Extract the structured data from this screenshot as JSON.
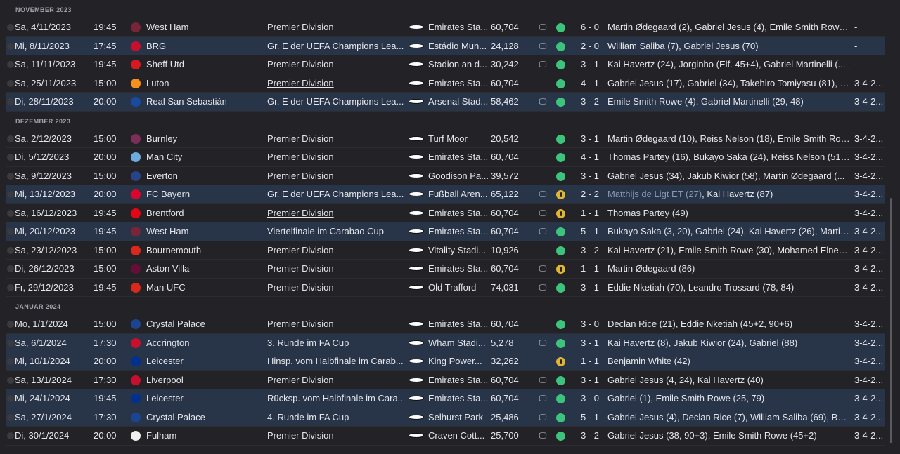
{
  "months": [
    {
      "label": "NOVEMBER 2023",
      "matches": [
        {
          "date": "Sa, 4/11/2023",
          "time": "19:45",
          "opponent": "West Ham",
          "crest": "#7a2437",
          "competition": "Premier Division",
          "comp_underline": false,
          "cup": false,
          "stadium": "Emirates Sta...",
          "attendance": "60,704",
          "tv": "tv-icon",
          "result": "win",
          "score": "6 - 0",
          "scorers": "Martin Ødegaard (2), Gabriel Jesus (4), Emile Smith Rowe...",
          "formation": "-"
        },
        {
          "date": "Mi, 8/11/2023",
          "time": "17:45",
          "opponent": "BRG",
          "crest": "#c8102e",
          "competition": "Gr. E der UEFA Champions Lea...",
          "comp_underline": false,
          "cup": true,
          "stadium": "Estádio Mun...",
          "attendance": "24,128",
          "tv": "tv-icon",
          "result": "win",
          "score": "2 - 0",
          "scorers": "William Saliba (7), Gabriel Jesus (70)",
          "formation": "-"
        },
        {
          "date": "Sa, 11/11/2023",
          "time": "19:45",
          "opponent": "Sheff Utd",
          "crest": "#d71920",
          "competition": "Premier Division",
          "comp_underline": false,
          "cup": false,
          "stadium": "Stadion an d...",
          "attendance": "30,242",
          "tv": "tv-icon",
          "result": "win",
          "score": "3 - 1",
          "scorers": "Kai Havertz (24), Jorginho (Elf. 45+4), Gabriel Martinelli (...",
          "formation": "-"
        },
        {
          "date": "Sa, 25/11/2023",
          "time": "15:00",
          "opponent": "Luton",
          "crest": "#f78f1e",
          "competition": "Premier Division",
          "comp_underline": true,
          "cup": false,
          "stadium": "Emirates Sta...",
          "attendance": "60,704",
          "tv": "",
          "result": "win",
          "score": "4 - 1",
          "scorers": "Gabriel Jesus (17), Gabriel (34), Takehiro Tomiyasu (81), B...",
          "formation": "3-4-2..."
        },
        {
          "date": "Di, 28/11/2023",
          "time": "20:00",
          "opponent": "Real San Sebastián",
          "crest": "#1a4aa0",
          "competition": "Gr. E der UEFA Champions Lea...",
          "comp_underline": false,
          "cup": true,
          "stadium": "Arsenal Stad...",
          "attendance": "58,462",
          "tv": "tv-icon",
          "result": "win",
          "score": "3 - 2",
          "scorers": "Emile Smith Rowe (4), Gabriel Martinelli (29, 48)",
          "formation": "3-4-2..."
        }
      ]
    },
    {
      "label": "DEZEMBER 2023",
      "matches": [
        {
          "date": "Sa, 2/12/2023",
          "time": "15:00",
          "opponent": "Burnley",
          "crest": "#7b2e57",
          "competition": "Premier Division",
          "comp_underline": false,
          "cup": false,
          "stadium": "Turf Moor",
          "attendance": "20,542",
          "tv": "",
          "result": "win",
          "score": "3 - 1",
          "scorers": "Martin Ødegaard (10), Reiss Nelson (18), Emile Smith Row...",
          "formation": "3-4-2..."
        },
        {
          "date": "Di, 5/12/2023",
          "time": "20:00",
          "opponent": "Man City",
          "crest": "#6cabdd",
          "competition": "Premier Division",
          "comp_underline": false,
          "cup": false,
          "stadium": "Emirates Sta...",
          "attendance": "60,704",
          "tv": "",
          "result": "win",
          "score": "4 - 1",
          "scorers": "Thomas Partey (16), Bukayo Saka (24), Reiss Nelson (51),...",
          "formation": "3-4-2..."
        },
        {
          "date": "Sa, 9/12/2023",
          "time": "15:00",
          "opponent": "Everton",
          "crest": "#274488",
          "competition": "Premier Division",
          "comp_underline": false,
          "cup": false,
          "stadium": "Goodison Pa...",
          "attendance": "39,572",
          "tv": "",
          "result": "win",
          "score": "3 - 1",
          "scorers": "Gabriel Jesus (34), Jakub Kiwior (58), Martin Ødegaard (...",
          "formation": "3-4-2..."
        },
        {
          "date": "Mi, 13/12/2023",
          "time": "20:00",
          "opponent": "FC Bayern",
          "crest": "#dc052d",
          "competition": "Gr. E der UEFA Champions Lea...",
          "comp_underline": false,
          "cup": true,
          "stadium": "Fußball Aren...",
          "attendance": "65,122",
          "tv": "tv-icon",
          "result": "draw",
          "score": "2 - 2",
          "scorers": "Matthijs de Ligt ET (27), Kai Havertz (87)",
          "scorer_against": "Matthijs de Ligt ET (27)",
          "scorer_rest": ", Kai Havertz (87)",
          "formation": "3-4-2..."
        },
        {
          "date": "Sa, 16/12/2023",
          "time": "19:45",
          "opponent": "Brentford",
          "crest": "#e30613",
          "competition": "Premier Division",
          "comp_underline": true,
          "cup": false,
          "stadium": "Emirates Sta...",
          "attendance": "60,704",
          "tv": "tv-icon",
          "result": "draw",
          "score": "1 - 1",
          "scorers": "Thomas Partey (49)",
          "formation": "3-4-2..."
        },
        {
          "date": "Mi, 20/12/2023",
          "time": "19:45",
          "opponent": "West Ham",
          "crest": "#7a2437",
          "competition": "Viertelfinale im Carabao Cup",
          "comp_underline": false,
          "cup": true,
          "stadium": "Emirates Sta...",
          "attendance": "60,704",
          "tv": "tv-icon",
          "result": "win",
          "score": "5 - 1",
          "scorers": "Bukayo Saka (3, 20), Gabriel (24), Kai Havertz (26), Martin...",
          "formation": "3-4-2..."
        },
        {
          "date": "Sa, 23/12/2023",
          "time": "15:00",
          "opponent": "Bournemouth",
          "crest": "#da291c",
          "competition": "Premier Division",
          "comp_underline": false,
          "cup": false,
          "stadium": "Vitality Stadi...",
          "attendance": "10,926",
          "tv": "",
          "result": "win",
          "score": "3 - 2",
          "scorers": "Kai Havertz (21), Emile Smith Rowe (30), Mohamed Elnen...",
          "formation": "3-4-2..."
        },
        {
          "date": "Di, 26/12/2023",
          "time": "15:00",
          "opponent": "Aston Villa",
          "crest": "#670e36",
          "competition": "Premier Division",
          "comp_underline": false,
          "cup": false,
          "stadium": "Emirates Sta...",
          "attendance": "60,704",
          "tv": "tv-icon",
          "result": "draw",
          "score": "1 - 1",
          "scorers": "Martin Ødegaard (86)",
          "formation": "3-4-2..."
        },
        {
          "date": "Fr, 29/12/2023",
          "time": "19:45",
          "opponent": "Man UFC",
          "crest": "#da291c",
          "competition": "Premier Division",
          "comp_underline": false,
          "cup": false,
          "stadium": "Old Trafford",
          "attendance": "74,031",
          "tv": "tv-icon",
          "result": "win",
          "score": "3 - 1",
          "scorers": "Eddie Nketiah (70), Leandro Trossard (78, 84)",
          "formation": "3-4-2..."
        }
      ]
    },
    {
      "label": "JANUAR 2024",
      "matches": [
        {
          "date": "Mo, 1/1/2024",
          "time": "15:00",
          "opponent": "Crystal Palace",
          "crest": "#1b458f",
          "competition": "Premier Division",
          "comp_underline": false,
          "cup": false,
          "stadium": "Emirates Sta...",
          "attendance": "60,704",
          "tv": "",
          "result": "win",
          "score": "3 - 0",
          "scorers": "Declan Rice (21), Eddie Nketiah (45+2, 90+6)",
          "formation": "3-4-2..."
        },
        {
          "date": "Sa, 6/1/2024",
          "time": "17:30",
          "opponent": "Accrington",
          "crest": "#c8102e",
          "competition": "3. Runde im FA Cup",
          "comp_underline": false,
          "cup": true,
          "stadium": "Wham Stadi...",
          "attendance": "5,278",
          "tv": "tv-icon",
          "result": "win",
          "score": "3 - 1",
          "scorers": "Kai Havertz (8), Jakub Kiwior (24), Gabriel (88)",
          "formation": "3-4-2..."
        },
        {
          "date": "Mi, 10/1/2024",
          "time": "20:00",
          "opponent": "Leicester",
          "crest": "#003090",
          "competition": "Hinsp. vom Halbfinale im Carab...",
          "comp_underline": false,
          "cup": true,
          "stadium": "King Power...",
          "attendance": "32,262",
          "tv": "",
          "result": "draw",
          "score": "1 - 1",
          "scorers": "Benjamin White (42)",
          "formation": "3-4-2..."
        },
        {
          "date": "Sa, 13/1/2024",
          "time": "17:30",
          "opponent": "Liverpool",
          "crest": "#c8102e",
          "competition": "Premier Division",
          "comp_underline": false,
          "cup": false,
          "stadium": "Emirates Sta...",
          "attendance": "60,704",
          "tv": "tv-icon",
          "result": "win",
          "score": "3 - 1",
          "scorers": "Gabriel Jesus (4, 24), Kai Havertz (40)",
          "formation": "3-4-2..."
        },
        {
          "date": "Mi, 24/1/2024",
          "time": "19:45",
          "opponent": "Leicester",
          "crest": "#003090",
          "competition": "Rücksp. vom Halbfinale im Cara...",
          "comp_underline": false,
          "cup": true,
          "stadium": "Emirates Sta...",
          "attendance": "60,704",
          "tv": "tv-icon",
          "result": "win",
          "score": "3 - 0",
          "scorers": "Gabriel (1), Emile Smith Rowe (25, 79)",
          "formation": "3-4-2..."
        },
        {
          "date": "Sa, 27/1/2024",
          "time": "17:30",
          "opponent": "Crystal Palace",
          "crest": "#1b458f",
          "competition": "4. Runde im FA Cup",
          "comp_underline": false,
          "cup": true,
          "stadium": "Selhurst Park",
          "attendance": "25,486",
          "tv": "tv-icon",
          "result": "win",
          "score": "5 - 1",
          "scorers": "Gabriel Jesus (4), Declan Rice (7), William Saliba (69), Buk...",
          "formation": "3-4-2..."
        },
        {
          "date": "Di, 30/1/2024",
          "time": "20:00",
          "opponent": "Fulham",
          "crest": "#f0f0f0",
          "competition": "Premier Division",
          "comp_underline": false,
          "cup": false,
          "stadium": "Craven Cott...",
          "attendance": "25,700",
          "tv": "tv-icon",
          "result": "win",
          "score": "3 - 2",
          "scorers": "Gabriel Jesus (38, 90+3), Emile Smith Rowe (45+2)",
          "formation": "3-4-2..."
        }
      ]
    }
  ],
  "icons": {
    "tv": "tv-icon",
    "venue": "stadium-icon",
    "result_win": "win-dot",
    "result_draw": "draw-dot"
  },
  "colors": {
    "background": "#232327",
    "cup_row": "#283549",
    "win": "#3cc47c",
    "draw": "#e0b530"
  }
}
